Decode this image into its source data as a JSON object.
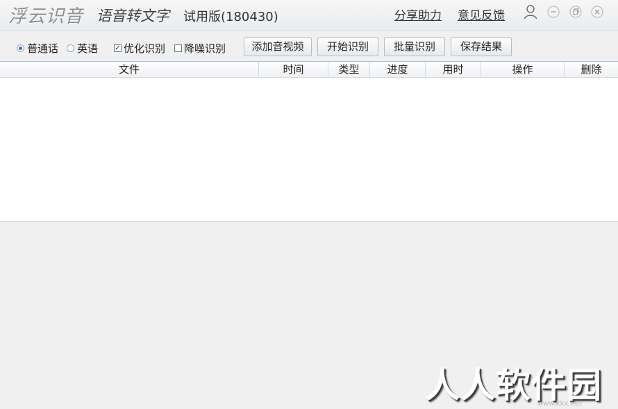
{
  "app": {
    "brand": "浮云识音",
    "subtitle": "语音转文字",
    "version": "试用版(180430)"
  },
  "header_links": {
    "share": "分享助力",
    "feedback": "意见反馈"
  },
  "icons": {
    "user": "user-icon",
    "minimize": "minimize-icon",
    "maximize": "maximize-icon",
    "close": "close-icon"
  },
  "options": {
    "mandarin": {
      "label": "普通话",
      "selected": true
    },
    "english": {
      "label": "英语",
      "selected": false
    },
    "optimize": {
      "label": "优化识别",
      "checked": true
    },
    "denoise": {
      "label": "降噪识别",
      "checked": false
    }
  },
  "toolbar": {
    "add_label": "添加音视频",
    "start_label": "开始识别",
    "batch_label": "批量识别",
    "save_label": "保存结果"
  },
  "table": {
    "columns": [
      "文件",
      "时间",
      "类型",
      "进度",
      "用时",
      "操作",
      "删除"
    ],
    "rows": []
  },
  "watermark": {
    "text": "人人软件园",
    "url": "www.kkx.net"
  },
  "colors": {
    "accent": "#2a7bd4",
    "table_border": "#a8c1d8",
    "background": "#f0f0f0"
  }
}
